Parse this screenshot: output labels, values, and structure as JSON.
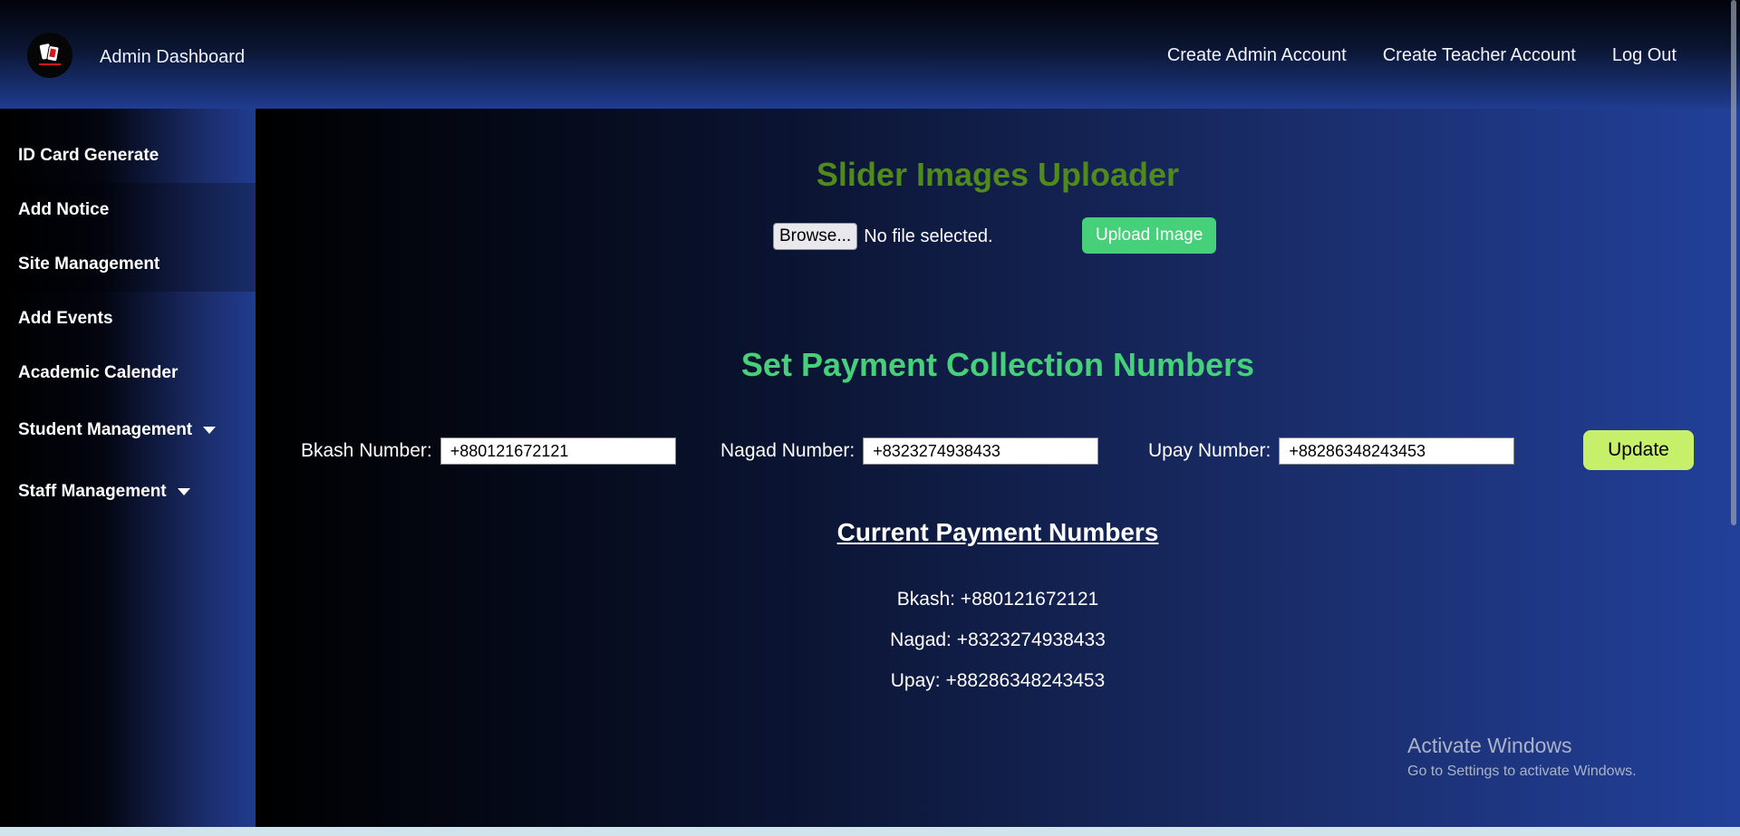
{
  "header": {
    "brand": "Admin Dashboard",
    "nav": [
      "Create Admin Account",
      "Create Teacher Account",
      "Log Out"
    ]
  },
  "sidebar": {
    "items": [
      {
        "label": "ID Card Generate"
      },
      {
        "label": "Add Notice"
      },
      {
        "label": "Site Management"
      },
      {
        "label": "Add Events"
      },
      {
        "label": "Academic Calender"
      },
      {
        "label": "Student Management",
        "dropdown": true
      },
      {
        "label": "Staff Management",
        "dropdown": true
      }
    ]
  },
  "slider": {
    "title": "Slider Images Uploader",
    "browse_label": "Browse...",
    "file_status": "No file selected.",
    "upload_label": "Upload Image"
  },
  "payment": {
    "title": "Set Payment Collection Numbers",
    "bkash_label": "Bkash Number:",
    "bkash_value": "+880121672121",
    "nagad_label": "Nagad Number:",
    "nagad_value": "+8323274938433",
    "upay_label": "Upay Number:",
    "upay_value": "+88286348243453",
    "update_label": "Update"
  },
  "current": {
    "title": "Current Payment Numbers",
    "lines": [
      "Bkash: +880121672121",
      "Nagad: +8323274938433",
      "Upay: +88286348243453"
    ]
  },
  "watermark": {
    "title": "Activate Windows",
    "subtitle": "Go to Settings to activate Windows."
  },
  "colors": {
    "slider_title": "#4f8a1b",
    "payment_title": "#46d07a",
    "upload_button": "#46d07a",
    "update_button": "#c6f06a"
  },
  "icons": {
    "logo": "school-logo-icon",
    "dropdown": "caret-down-icon"
  }
}
